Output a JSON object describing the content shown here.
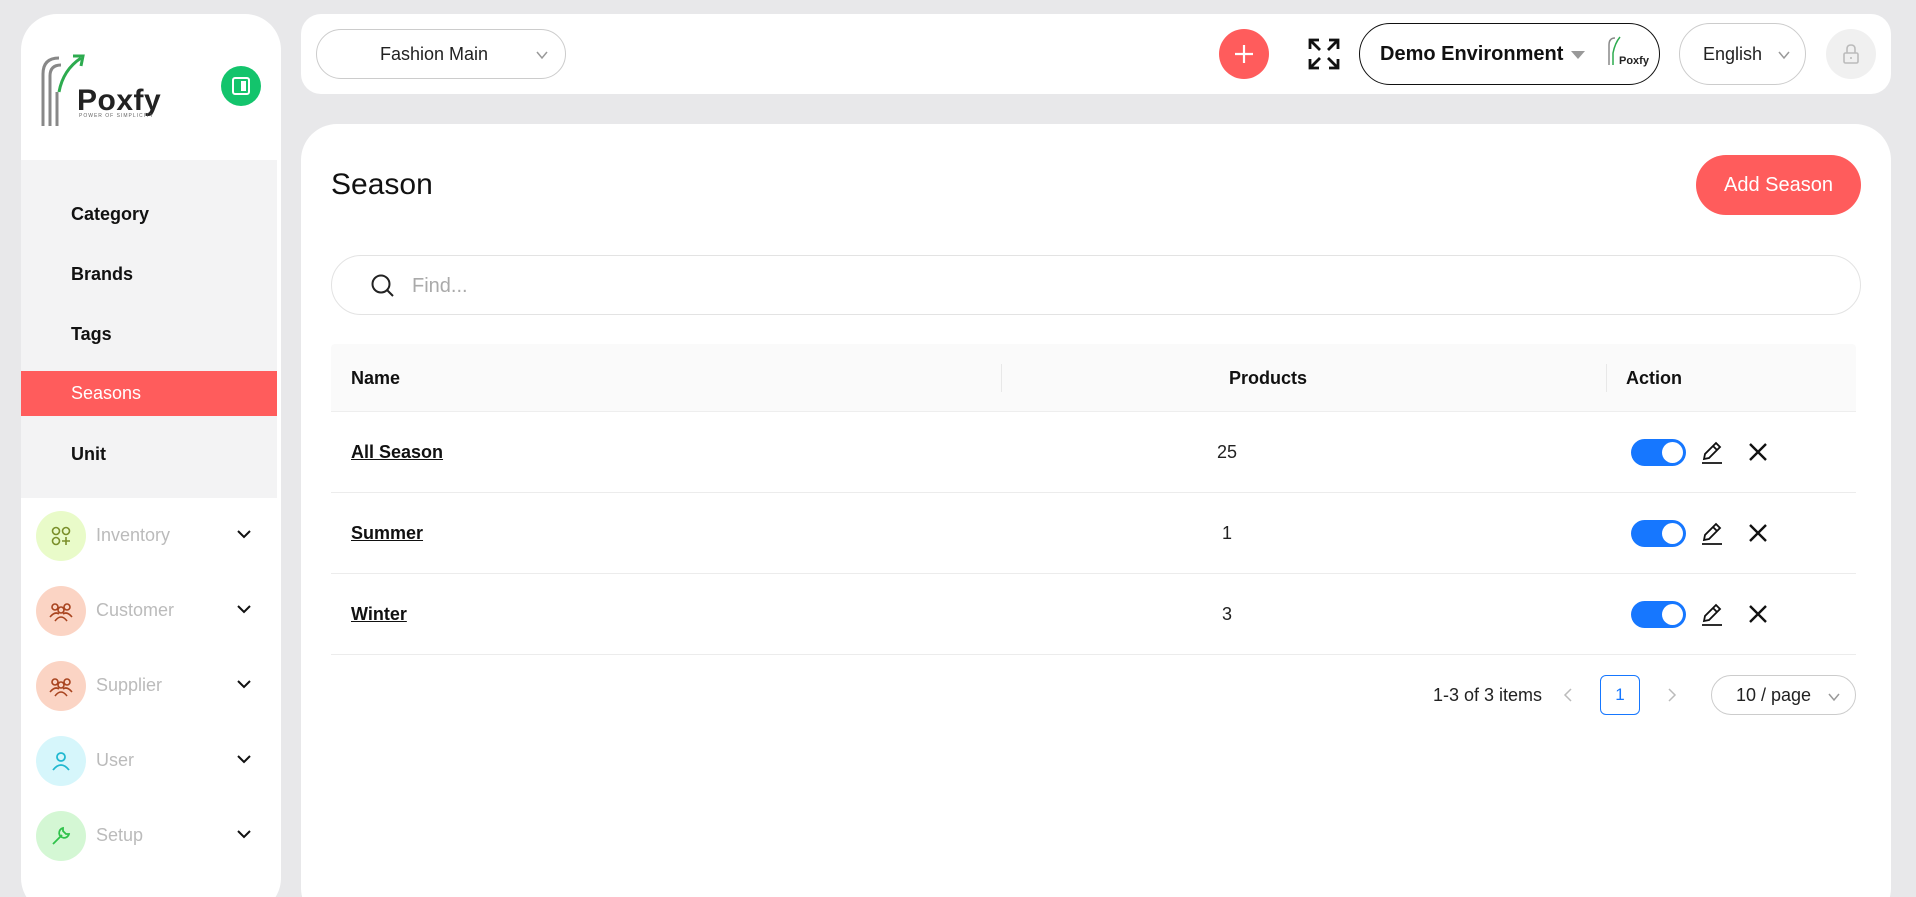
{
  "brand": {
    "name": "Poxfy",
    "tagline": "POWER OF SIMPLICITY"
  },
  "sidebar": {
    "submenu": [
      {
        "label": "Category"
      },
      {
        "label": "Brands"
      },
      {
        "label": "Tags"
      },
      {
        "label": "Seasons",
        "active": true
      },
      {
        "label": "Unit"
      }
    ],
    "groups": [
      {
        "label": "Inventory",
        "icon": "inventory-icon",
        "color": "#e9fbc9"
      },
      {
        "label": "Customer",
        "icon": "customer-icon",
        "color": "#fbd4c4"
      },
      {
        "label": "Supplier",
        "icon": "supplier-icon",
        "color": "#fbd4c4"
      },
      {
        "label": "User",
        "icon": "user-icon",
        "color": "#d6f6fb"
      },
      {
        "label": "Setup",
        "icon": "wrench-icon",
        "color": "#d4f7d4"
      }
    ]
  },
  "topbar": {
    "store": "Fashion Main",
    "environment": "Demo Environment",
    "environment_logo_text": "Poxfy",
    "language": "English"
  },
  "page": {
    "title": "Season",
    "add_button": "Add Season",
    "search_placeholder": "Find..."
  },
  "table": {
    "headers": {
      "name": "Name",
      "products": "Products",
      "action": "Action"
    },
    "rows": [
      {
        "name": "All Season",
        "products": "25",
        "enabled": true
      },
      {
        "name": "Summer",
        "products": "1",
        "enabled": true
      },
      {
        "name": "Winter",
        "products": "3",
        "enabled": true
      }
    ]
  },
  "pagination": {
    "total_text": "1-3 of 3 items",
    "current_page": "1",
    "page_size": "10 / page"
  },
  "colors": {
    "accent": "#ff5c5c",
    "toggle": "#1677ff",
    "collapse": "#13c46c"
  }
}
